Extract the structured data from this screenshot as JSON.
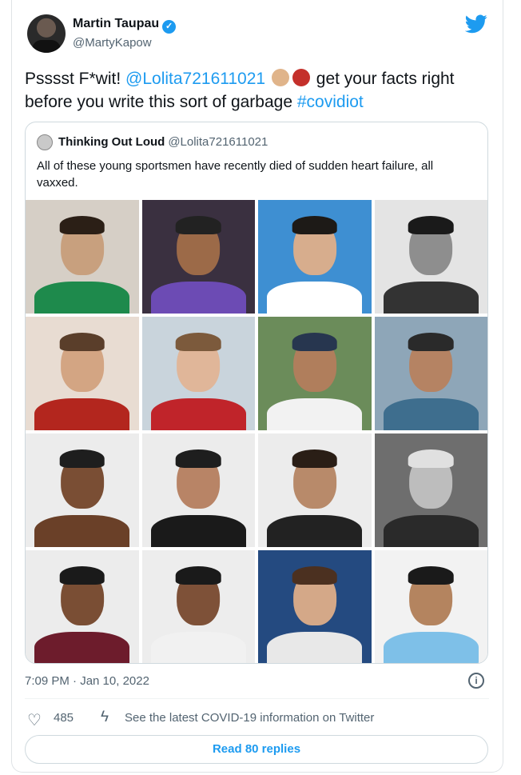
{
  "author": {
    "name": "Martin Taupau",
    "handle": "@MartyKapow",
    "verified_mark": "✓"
  },
  "tweet": {
    "text_1": "Psssst F*wit! ",
    "mention": "@Lolita721611021",
    "text_2": " get your facts right before you write this sort of garbage ",
    "hashtag": "#covidiot",
    "emoji_icons": [
      "middle-finger-icon",
      "angry-face-icon"
    ]
  },
  "quoted": {
    "name": "Thinking Out Loud",
    "handle": "@Lolita721611021",
    "text": "All of these young sportsmen have recently died of sudden heart failure, all vaxxed.",
    "photos": [
      {
        "bg": "#d6cfc6",
        "skin": "#c8a07e",
        "shirt": "#1e8a4c",
        "hair": "#2b1f16"
      },
      {
        "bg": "#3a3040",
        "skin": "#9c6a48",
        "shirt": "#6c4bb4",
        "hair": "#222222"
      },
      {
        "bg": "#3e8fd2",
        "skin": "#d7ad8d",
        "shirt": "#ffffff",
        "hair": "#1d1a17"
      },
      {
        "bg": "#e4e4e4",
        "skin": "#8e8e8e",
        "shirt": "#333333",
        "hair": "#1a1a1a"
      },
      {
        "bg": "#e8dcd2",
        "skin": "#d3a583",
        "shirt": "#b3261e",
        "hair": "#5a3e2a"
      },
      {
        "bg": "#c9d4dc",
        "skin": "#e0b699",
        "shirt": "#c0242a",
        "hair": "#7c5a3c"
      },
      {
        "bg": "#6b8c5a",
        "skin": "#b07e5c",
        "shirt": "#f2f2f2",
        "hair": "#27364f"
      },
      {
        "bg": "#8ea6b8",
        "skin": "#b58363",
        "shirt": "#3e6e8e",
        "hair": "#2a2a2a"
      },
      {
        "bg": "#ececec",
        "skin": "#7a4e34",
        "shirt": "#6a4028",
        "hair": "#1e1e1e"
      },
      {
        "bg": "#ececec",
        "skin": "#b88466",
        "shirt": "#1a1a1a",
        "hair": "#1e1e1e"
      },
      {
        "bg": "#ececec",
        "skin": "#b88a6a",
        "shirt": "#222222",
        "hair": "#2a1e16"
      },
      {
        "bg": "#6e6e6e",
        "skin": "#bdbdbd",
        "shirt": "#2a2a2a",
        "hair": "#e0e0e0"
      },
      {
        "bg": "#ececec",
        "skin": "#7a4e34",
        "shirt": "#6d1c2c",
        "hair": "#1a1a1a"
      },
      {
        "bg": "#ededed",
        "skin": "#7e5138",
        "shirt": "#f1f1f1",
        "hair": "#1a1a1a"
      },
      {
        "bg": "#244a80",
        "skin": "#d4a888",
        "shirt": "#e8e8e8",
        "hair": "#4b3020"
      },
      {
        "bg": "#f2f2f2",
        "skin": "#b4845f",
        "shirt": "#7ec0e8",
        "hair": "#1a1a1a"
      }
    ]
  },
  "meta": {
    "time": "7:09 PM · Jan 10, 2022",
    "info_icon_glyph": "i"
  },
  "actions": {
    "likes": "485",
    "covid_link": "See the latest COVID-19 information on Twitter",
    "heart_glyph": "♡",
    "bolt_glyph": "ϟ"
  },
  "replies_button": "Read 80 replies",
  "colors": {
    "accent": "#1d9bf0",
    "muted": "#536471"
  }
}
